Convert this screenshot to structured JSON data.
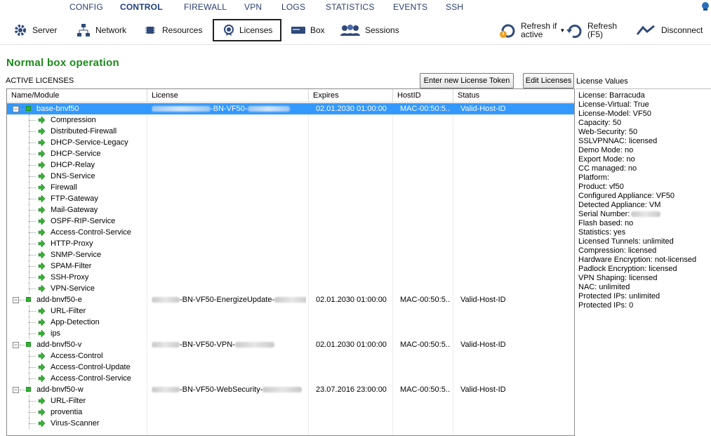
{
  "topnav": [
    "CONFIG",
    "CONTROL",
    "FIREWALL",
    "VPN",
    "LOGS",
    "STATISTICS",
    "EVENTS",
    "SSH"
  ],
  "toolbar": {
    "server": "Server",
    "network": "Network",
    "resources": "Resources",
    "licenses": "Licenses",
    "box": "Box",
    "sessions": "Sessions",
    "refresh_if_1": "Refresh if",
    "refresh_if_2": "active",
    "refresh_1": "Refresh",
    "refresh_2": "(F5)",
    "disconnect": "Disconnect"
  },
  "status_title": "Normal box operation",
  "section_label": "ACTIVE LICENSES",
  "buttons": {
    "enter_token": "Enter new License Token",
    "edit": "Edit Licenses"
  },
  "values_label": "License Values",
  "columns": [
    "Name/Module",
    "License",
    "Expires",
    "HostID",
    "Status"
  ],
  "rows": [
    {
      "name": "base-bnvf50",
      "license": "-BN-VF50-",
      "expires": "02.01.2030 01:00:00",
      "host": "MAC-00:50:5...",
      "status": "Valid-Host-ID"
    },
    {
      "name": "Compression"
    },
    {
      "name": "Distributed-Firewall"
    },
    {
      "name": "DHCP-Service-Legacy"
    },
    {
      "name": "DHCP-Service"
    },
    {
      "name": "DHCP-Relay"
    },
    {
      "name": "DNS-Service"
    },
    {
      "name": "Firewall"
    },
    {
      "name": "FTP-Gateway"
    },
    {
      "name": "Mail-Gateway"
    },
    {
      "name": "OSPF-RIP-Service"
    },
    {
      "name": "Access-Control-Service"
    },
    {
      "name": "HTTP-Proxy"
    },
    {
      "name": "SNMP-Service"
    },
    {
      "name": "SPAM-Filter"
    },
    {
      "name": "SSH-Proxy"
    },
    {
      "name": "VPN-Service"
    },
    {
      "name": "add-bnvf50-e",
      "license": "-BN-VF50-EnergizeUpdate-",
      "expires": "02.01.2030 01:00:00",
      "host": "MAC-00:50:5...",
      "status": "Valid-Host-ID"
    },
    {
      "name": "URL-Filter"
    },
    {
      "name": "App-Detection"
    },
    {
      "name": "ips"
    },
    {
      "name": "add-bnvf50-v",
      "license": "-BN-VF50-VPN-",
      "expires": "02.01.2030 01:00:00",
      "host": "MAC-00:50:5...",
      "status": "Valid-Host-ID"
    },
    {
      "name": "Access-Control"
    },
    {
      "name": "Access-Control-Update"
    },
    {
      "name": "Access-Control-Service"
    },
    {
      "name": "add-bnvf50-w",
      "license": "-BN-VF50-WebSecurity-",
      "expires": "23.07.2016 23:00:00",
      "host": "MAC-00:50:5...",
      "status": "Valid-Host-ID"
    },
    {
      "name": "URL-Filter"
    },
    {
      "name": "proventia"
    },
    {
      "name": "Virus-Scanner"
    }
  ],
  "license_values": [
    "License: Barracuda",
    "License-Virtual: True",
    "License-Model: VF50",
    "Capacity: 50",
    "Web-Security: 50",
    "SSLVPNNAC: licensed",
    "Demo Mode: no",
    "Export Mode: no",
    "CC managed: no",
    "Platform:",
    "Product: vf50",
    "Configured Appliance: VF50",
    "Detected Appliance: VM",
    "Serial Number:",
    "Flash based: no",
    "Statistics: yes",
    "Licensed Tunnels: unlimited",
    "Compression: licensed",
    "Hardware Encryption: not-licensed",
    "Padlock Encryption: licensed",
    "VPN Shaping: licensed",
    "NAC: unlimited",
    "Protected IPs: unlimited",
    "Protected IPs: 0"
  ]
}
